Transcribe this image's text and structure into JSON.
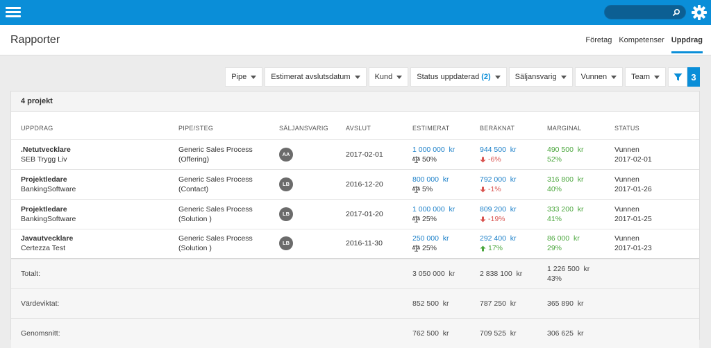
{
  "header": {
    "title": "Rapporter",
    "nav": [
      {
        "label": "Företag"
      },
      {
        "label": "Kompetenser"
      },
      {
        "label": "Uppdrag"
      }
    ]
  },
  "search": {
    "placeholder": ""
  },
  "filters": [
    {
      "label": "Pipe",
      "count": ""
    },
    {
      "label": "Estimerat avslutsdatum",
      "count": ""
    },
    {
      "label": "Kund",
      "count": ""
    },
    {
      "label": "Status uppdaterad",
      "count": "(2)"
    },
    {
      "label": "Säljansvarig",
      "count": ""
    },
    {
      "label": "Vunnen",
      "count": ""
    },
    {
      "label": "Team",
      "count": ""
    }
  ],
  "filter_badge": "3",
  "panel": {
    "title": "4 projekt"
  },
  "columns": [
    "Uppdrag",
    "Pipe/Steg",
    "Säljansvarig",
    "Avslut",
    "Estimerat",
    "Beräknat",
    "Marginal",
    "Status"
  ],
  "rows": [
    {
      "title": ".Netutvecklare",
      "customer": "SEB Trygg Liv",
      "pipe": "Generic Sales Process",
      "step": "(Offering)",
      "owner": "AA",
      "close": "2017-02-01",
      "est": "1 000 000  kr",
      "prob": "50%",
      "calc": "944 500  kr",
      "diff": "-6%",
      "diff_dir": "down",
      "margin": "490 500  kr",
      "margin_pct": "52%",
      "status": "Vunnen",
      "status_date": "2017-02-01"
    },
    {
      "title": "Projektledare",
      "customer": "BankingSoftware",
      "pipe": "Generic Sales Process",
      "step": "(Contact)",
      "owner": "LB",
      "close": "2016-12-20",
      "est": "800 000  kr",
      "prob": "5%",
      "calc": "792 000  kr",
      "diff": "-1%",
      "diff_dir": "down",
      "margin": "316 800  kr",
      "margin_pct": "40%",
      "status": "Vunnen",
      "status_date": "2017-01-26"
    },
    {
      "title": "Projektledare",
      "customer": "BankingSoftware",
      "pipe": "Generic Sales Process",
      "step": "(Solution )",
      "owner": "LB",
      "close": "2017-01-20",
      "est": "1 000 000  kr",
      "prob": "25%",
      "calc": "809 200  kr",
      "diff": "-19%",
      "diff_dir": "down",
      "margin": "333 200  kr",
      "margin_pct": "41%",
      "status": "Vunnen",
      "status_date": "2017-01-25"
    },
    {
      "title": "Javautvecklare",
      "customer": "Certezza Test",
      "pipe": "Generic Sales Process",
      "step": "(Solution )",
      "owner": "LB",
      "close": "2016-11-30",
      "est": "250 000  kr",
      "prob": "25%",
      "calc": "292 400  kr",
      "diff": "17%",
      "diff_dir": "up",
      "margin": "86 000  kr",
      "margin_pct": "29%",
      "status": "Vunnen",
      "status_date": "2017-01-23"
    }
  ],
  "totals": {
    "total": {
      "label": "Totalt:",
      "est": "3 050 000  kr",
      "calc": "2 838 100  kr",
      "margin": "1 226 500  kr",
      "margin_pct": "43%"
    },
    "weighted": {
      "label": "Värdeviktat:",
      "est": "852 500  kr",
      "calc": "787 250  kr",
      "margin": "365 890  kr"
    },
    "average": {
      "label": "Genomsnitt:",
      "est": "762 500  kr",
      "calc": "709 525  kr",
      "margin": "306 625  kr"
    }
  },
  "colors": {
    "accent": "#0a8ed8",
    "positive": "#4aa63c",
    "negative": "#d9534f",
    "value": "#1a7fc8"
  }
}
